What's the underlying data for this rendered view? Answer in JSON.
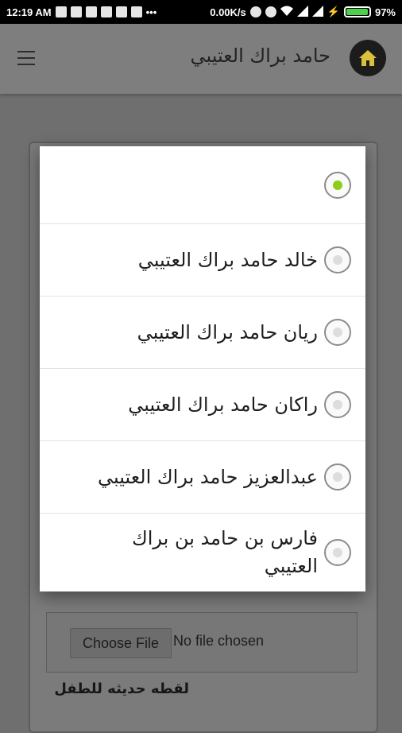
{
  "status_bar": {
    "time": "12:19 AM",
    "net_speed": "0.00K/s",
    "battery": "97%",
    "battery_level": 0.97
  },
  "app_bar": {
    "title": "حامد براك العتيبي",
    "menu_icon": "hamburger-icon",
    "home_icon": "home-icon"
  },
  "form": {
    "choose_file_label": "Choose File",
    "no_file_text": "No file chosen",
    "photo_label": "لقطه حديثه للطفل"
  },
  "dialog": {
    "options": [
      {
        "label": "",
        "checked": true
      },
      {
        "label": "خالد حامد براك العتيبي",
        "checked": false
      },
      {
        "label": "ريان حامد براك العتيبي",
        "checked": false
      },
      {
        "label": "راكان حامد براك العتيبي",
        "checked": false
      },
      {
        "label": "عبدالعزيز حامد براك العتيبي",
        "checked": false
      },
      {
        "label": "فارس بن حامد بن براك العتيبي",
        "checked": false
      }
    ]
  },
  "colors": {
    "radio_checked": "#8ccf1b",
    "battery": "#4cd14c"
  }
}
